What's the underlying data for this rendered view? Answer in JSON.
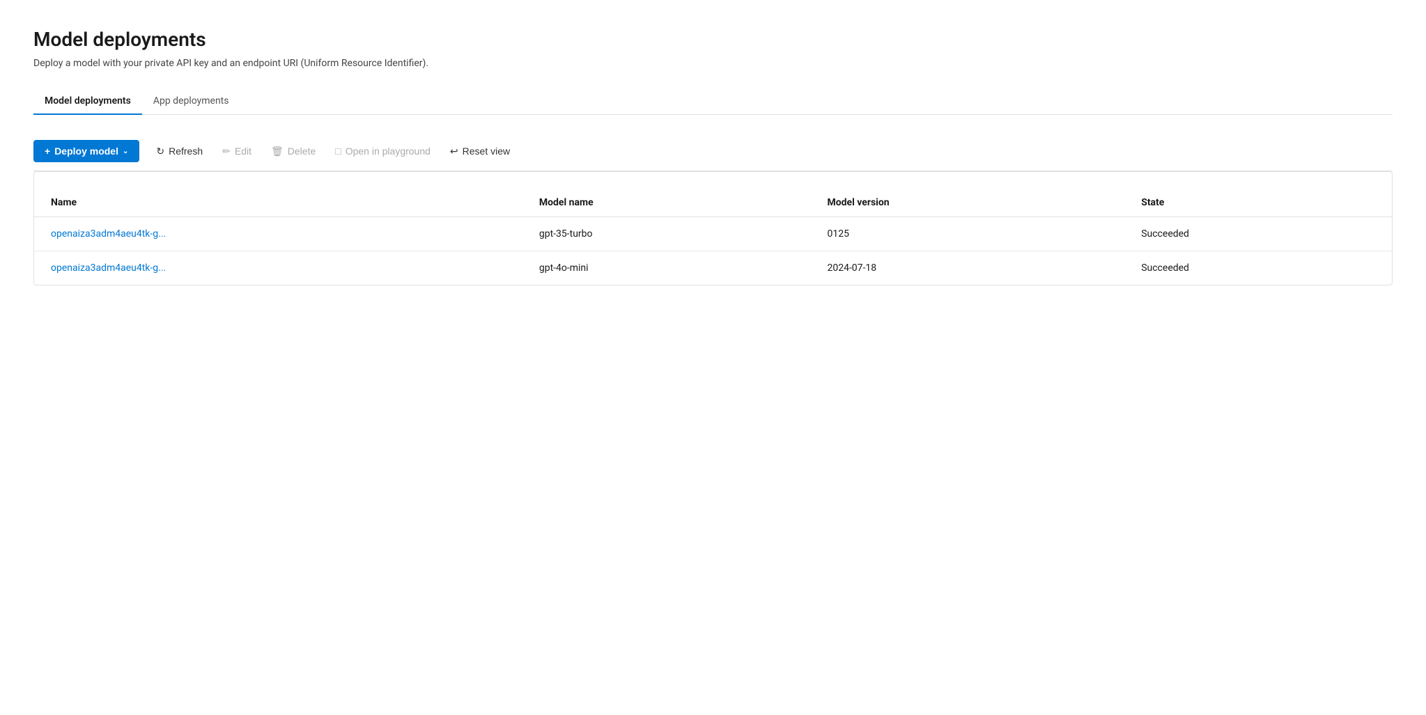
{
  "page": {
    "title": "Model deployments",
    "subtitle": "Deploy a model with your private API key and an endpoint URI (Uniform Resource Identifier)."
  },
  "tabs": [
    {
      "id": "model-deployments",
      "label": "Model deployments",
      "active": true
    },
    {
      "id": "app-deployments",
      "label": "App deployments",
      "active": false
    }
  ],
  "toolbar": {
    "deploy_label": "Deploy model",
    "refresh_label": "Refresh",
    "edit_label": "Edit",
    "delete_label": "Delete",
    "open_playground_label": "Open in playground",
    "reset_view_label": "Reset view"
  },
  "table": {
    "columns": [
      {
        "id": "name",
        "label": "Name"
      },
      {
        "id": "model_name",
        "label": "Model name"
      },
      {
        "id": "model_version",
        "label": "Model version"
      },
      {
        "id": "state",
        "label": "State"
      }
    ],
    "rows": [
      {
        "name": "openaiza3adm4aeu4tk-g...",
        "model_name": "gpt-35-turbo",
        "model_version": "0125",
        "state": "Succeeded"
      },
      {
        "name": "openaiza3adm4aeu4tk-g...",
        "model_name": "gpt-4o-mini",
        "model_version": "2024-07-18",
        "state": "Succeeded"
      }
    ]
  }
}
